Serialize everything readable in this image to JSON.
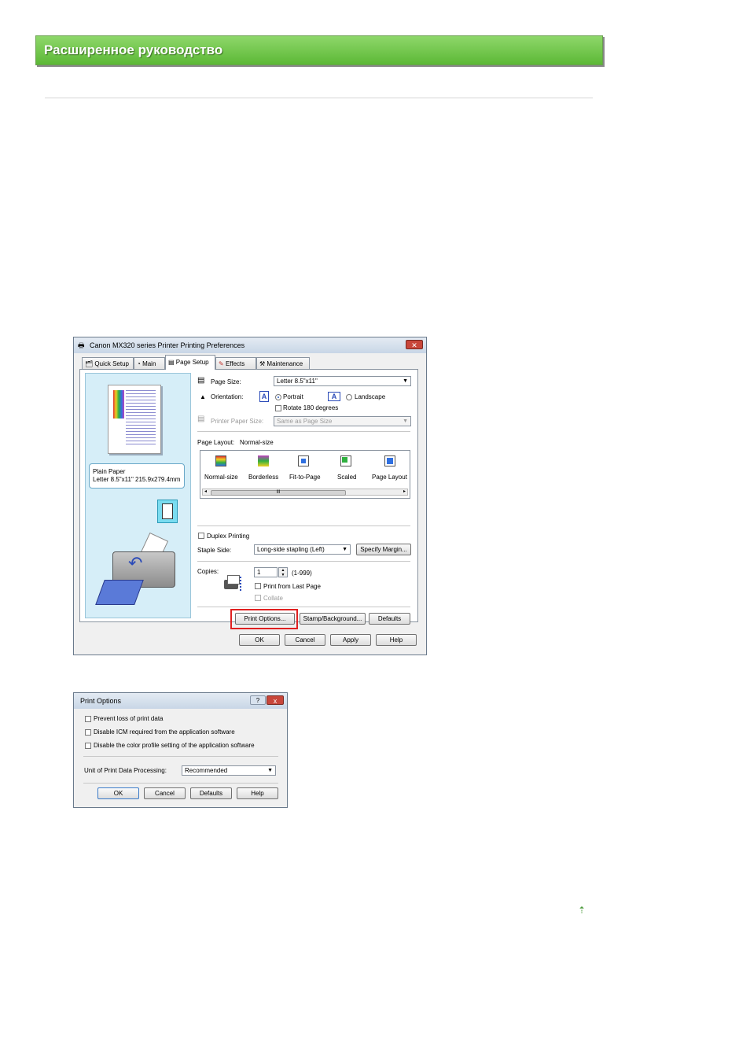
{
  "banner": {
    "title": "Расширенное руководство"
  },
  "dialog1": {
    "title": "Canon MX320 series Printer Printing Preferences",
    "tabs": [
      "Quick Setup",
      "Main",
      "Page Setup",
      "Effects",
      "Maintenance"
    ],
    "active_tab": "Page Setup",
    "media_info": {
      "line1": "Plain Paper",
      "line2": "Letter 8.5\"x11\" 215.9x279.4mm"
    },
    "page_size_label": "Page Size:",
    "page_size_value": "Letter 8.5\"x11\"",
    "orientation_label": "Orientation:",
    "portrait": "Portrait",
    "landscape": "Landscape",
    "rotate180": "Rotate 180 degrees",
    "printer_paper_size_label": "Printer Paper Size:",
    "printer_paper_size_value": "Same as Page Size",
    "page_layout_label": "Page Layout:",
    "page_layout_value": "Normal-size",
    "layouts": [
      "Normal-size",
      "Borderless",
      "Fit-to-Page",
      "Scaled",
      "Page Layout"
    ],
    "scroll_mark": "III",
    "duplex": "Duplex Printing",
    "staple_label": "Staple Side:",
    "staple_value": "Long-side stapling (Left)",
    "specify_margin": "Specify Margin...",
    "copies_label": "Copies:",
    "copies_value": "1",
    "copies_range": "(1-999)",
    "print_from_last": "Print from Last Page",
    "collate": "Collate",
    "print_options": "Print Options...",
    "stamp_background": "Stamp/Background...",
    "defaults": "Defaults",
    "ok": "OK",
    "cancel": "Cancel",
    "apply": "Apply",
    "help": "Help"
  },
  "dialog2": {
    "title": "Print Options",
    "help_btn": "?",
    "close_btn": "x",
    "opt1": "Prevent loss of print data",
    "opt2": "Disable ICM required from the application software",
    "opt3": "Disable the color profile setting of the application software",
    "unit_label": "Unit of Print Data Processing:",
    "unit_value": "Recommended",
    "ok": "OK",
    "cancel": "Cancel",
    "defaults": "Defaults",
    "help": "Help"
  },
  "colors": {
    "banner": "#5cb836",
    "highlight": "#e02020"
  }
}
